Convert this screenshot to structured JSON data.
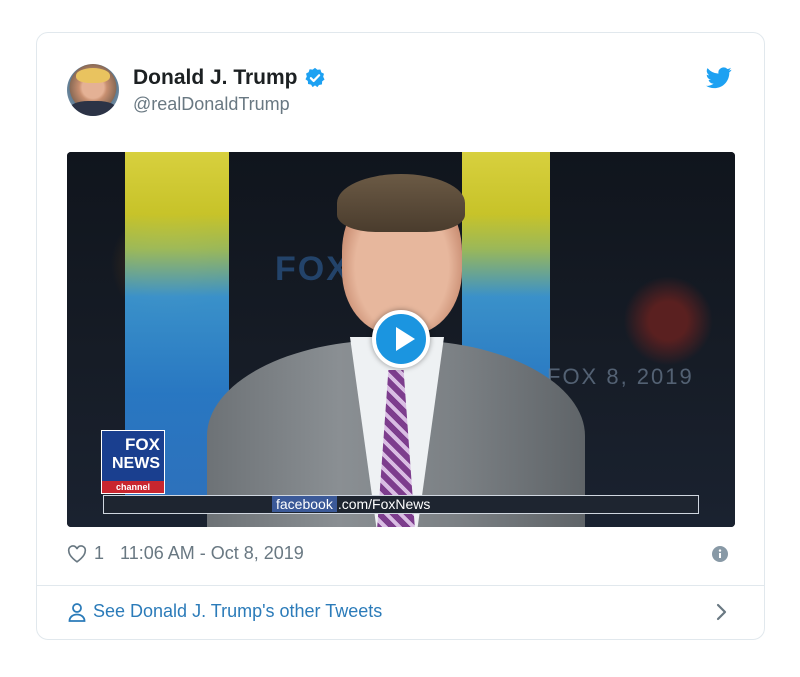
{
  "tweet": {
    "author_name": "Donald J. Trump",
    "handle": "@realDonaldTrump",
    "likes": "1",
    "timestamp": "11:06 AM - Oct 8, 2019"
  },
  "video": {
    "wall_text": "FOX",
    "date_sign": "FOX 8, 2019",
    "logo": {
      "line1": "FOX",
      "line2": "NEWS",
      "line3": "channel"
    },
    "lower_third": {
      "badge": "facebook",
      "text": ".com/FoxNews"
    }
  },
  "footer": {
    "link_label": "See Donald J. Trump's other Tweets"
  },
  "colors": {
    "accent": "#1b95e0",
    "link": "#2b7bb9",
    "muted": "#697882",
    "border": "#e1e8ed"
  },
  "icons": [
    "verified-badge-icon",
    "twitter-bird-icon",
    "play-icon",
    "heart-icon",
    "info-icon",
    "person-icon",
    "chevron-right-icon"
  ]
}
